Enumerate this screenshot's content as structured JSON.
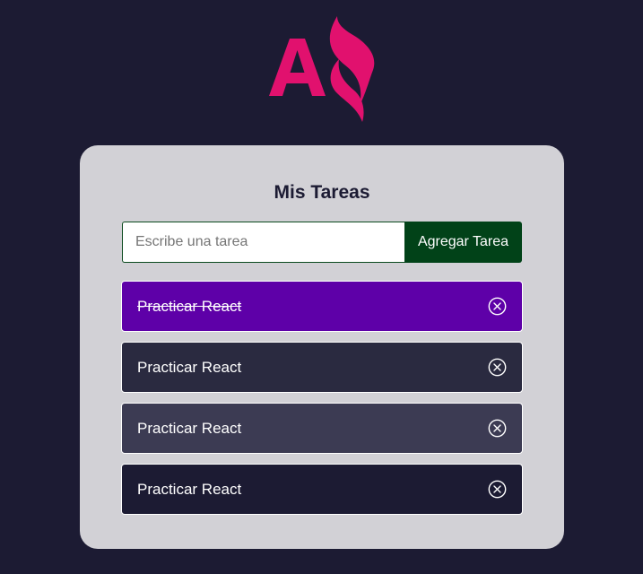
{
  "header": {
    "logo": {
      "icon": "logo-a-flame",
      "color": "#e1116e"
    }
  },
  "card": {
    "title": "Mis Tareas"
  },
  "form": {
    "input_placeholder": "Escribe una tarea",
    "input_value": "",
    "add_label": "Agregar Tarea"
  },
  "tasks": [
    {
      "label": "Practicar React",
      "completed": true,
      "color": "#5e00a8",
      "delete_icon": "circle-x-icon"
    },
    {
      "label": "Practicar React",
      "completed": false,
      "color": "#2a2a40",
      "delete_icon": "circle-x-icon"
    },
    {
      "label": "Practicar React",
      "completed": false,
      "color": "#3c3b53",
      "delete_icon": "circle-x-icon"
    },
    {
      "label": "Practicar React",
      "completed": false,
      "color": "#1c1b33",
      "delete_icon": "circle-x-icon"
    }
  ]
}
